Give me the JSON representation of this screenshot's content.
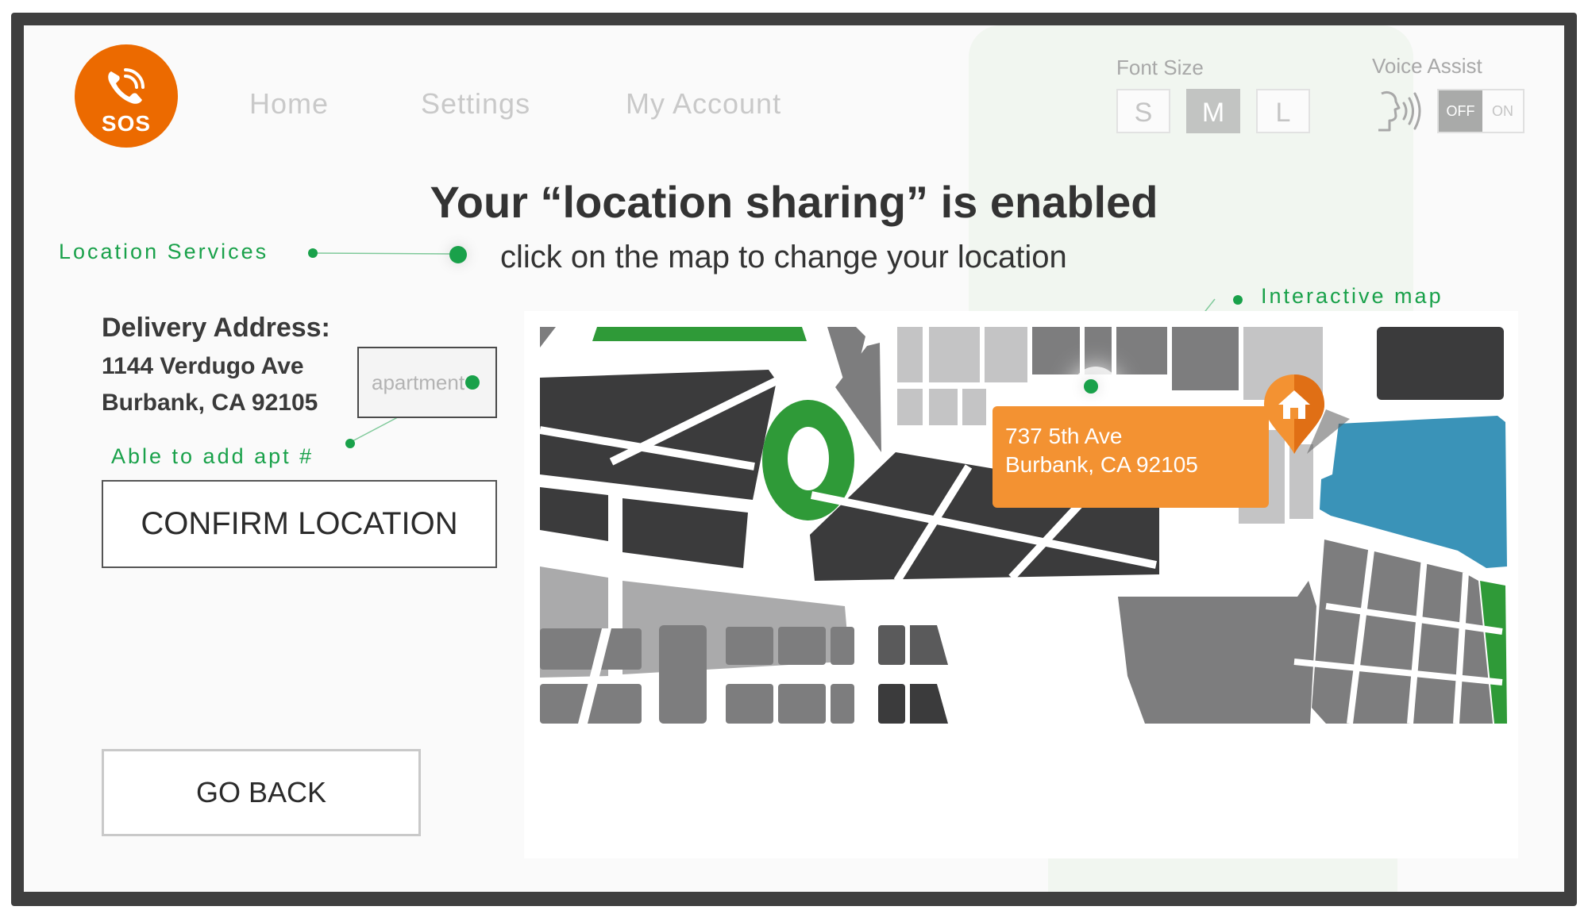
{
  "header": {
    "sos_label": "SOS",
    "nav": [
      "Home",
      "Settings",
      "My Account"
    ]
  },
  "font_size": {
    "label": "Font Size",
    "options": [
      "S",
      "M",
      "L"
    ],
    "selected": "M"
  },
  "voice_assist": {
    "label": "Voice Assist",
    "off_label": "OFF",
    "on_label": "ON",
    "state": "OFF"
  },
  "headline": "Your “location sharing” is enabled",
  "subline": "click on the map to change your location",
  "annotations": {
    "location_services": "Location Services",
    "interactive_map": "Interactive map",
    "apt": "Able to add apt #"
  },
  "delivery": {
    "title": "Delivery Address:",
    "line1": "1144 Verdugo Ave",
    "line2": "Burbank, CA 92105",
    "apt_placeholder": "apartment"
  },
  "buttons": {
    "confirm": "CONFIRM LOCATION",
    "go_back": "GO BACK"
  },
  "map_callout": {
    "line1": "737 5th Ave",
    "line2": "Burbank, CA 92105"
  },
  "colors": {
    "accent_orange": "#ec6a00",
    "callout_orange": "#f39232",
    "annotation_green": "#19a14a",
    "park_green": "#2f9a38",
    "water_blue": "#3a93b8"
  }
}
